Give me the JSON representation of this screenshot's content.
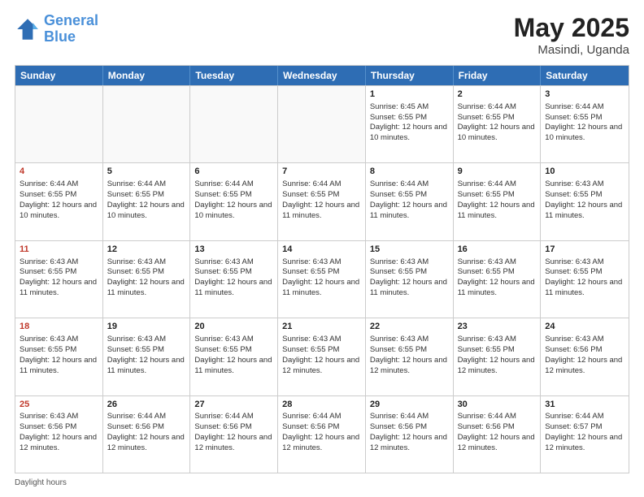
{
  "logo": {
    "line1": "General",
    "line2": "Blue"
  },
  "title": "May 2025",
  "location": "Masindi, Uganda",
  "days_of_week": [
    "Sunday",
    "Monday",
    "Tuesday",
    "Wednesday",
    "Thursday",
    "Friday",
    "Saturday"
  ],
  "footer": "Daylight hours",
  "weeks": [
    [
      {
        "day": "",
        "empty": true
      },
      {
        "day": "",
        "empty": true
      },
      {
        "day": "",
        "empty": true
      },
      {
        "day": "",
        "empty": true
      },
      {
        "day": "1",
        "sunrise": "Sunrise: 6:45 AM",
        "sunset": "Sunset: 6:55 PM",
        "daylight": "Daylight: 12 hours and 10 minutes."
      },
      {
        "day": "2",
        "sunrise": "Sunrise: 6:44 AM",
        "sunset": "Sunset: 6:55 PM",
        "daylight": "Daylight: 12 hours and 10 minutes."
      },
      {
        "day": "3",
        "sunrise": "Sunrise: 6:44 AM",
        "sunset": "Sunset: 6:55 PM",
        "daylight": "Daylight: 12 hours and 10 minutes."
      }
    ],
    [
      {
        "day": "4",
        "sunrise": "Sunrise: 6:44 AM",
        "sunset": "Sunset: 6:55 PM",
        "daylight": "Daylight: 12 hours and 10 minutes."
      },
      {
        "day": "5",
        "sunrise": "Sunrise: 6:44 AM",
        "sunset": "Sunset: 6:55 PM",
        "daylight": "Daylight: 12 hours and 10 minutes."
      },
      {
        "day": "6",
        "sunrise": "Sunrise: 6:44 AM",
        "sunset": "Sunset: 6:55 PM",
        "daylight": "Daylight: 12 hours and 10 minutes."
      },
      {
        "day": "7",
        "sunrise": "Sunrise: 6:44 AM",
        "sunset": "Sunset: 6:55 PM",
        "daylight": "Daylight: 12 hours and 11 minutes."
      },
      {
        "day": "8",
        "sunrise": "Sunrise: 6:44 AM",
        "sunset": "Sunset: 6:55 PM",
        "daylight": "Daylight: 12 hours and 11 minutes."
      },
      {
        "day": "9",
        "sunrise": "Sunrise: 6:44 AM",
        "sunset": "Sunset: 6:55 PM",
        "daylight": "Daylight: 12 hours and 11 minutes."
      },
      {
        "day": "10",
        "sunrise": "Sunrise: 6:43 AM",
        "sunset": "Sunset: 6:55 PM",
        "daylight": "Daylight: 12 hours and 11 minutes."
      }
    ],
    [
      {
        "day": "11",
        "sunrise": "Sunrise: 6:43 AM",
        "sunset": "Sunset: 6:55 PM",
        "daylight": "Daylight: 12 hours and 11 minutes."
      },
      {
        "day": "12",
        "sunrise": "Sunrise: 6:43 AM",
        "sunset": "Sunset: 6:55 PM",
        "daylight": "Daylight: 12 hours and 11 minutes."
      },
      {
        "day": "13",
        "sunrise": "Sunrise: 6:43 AM",
        "sunset": "Sunset: 6:55 PM",
        "daylight": "Daylight: 12 hours and 11 minutes."
      },
      {
        "day": "14",
        "sunrise": "Sunrise: 6:43 AM",
        "sunset": "Sunset: 6:55 PM",
        "daylight": "Daylight: 12 hours and 11 minutes."
      },
      {
        "day": "15",
        "sunrise": "Sunrise: 6:43 AM",
        "sunset": "Sunset: 6:55 PM",
        "daylight": "Daylight: 12 hours and 11 minutes."
      },
      {
        "day": "16",
        "sunrise": "Sunrise: 6:43 AM",
        "sunset": "Sunset: 6:55 PM",
        "daylight": "Daylight: 12 hours and 11 minutes."
      },
      {
        "day": "17",
        "sunrise": "Sunrise: 6:43 AM",
        "sunset": "Sunset: 6:55 PM",
        "daylight": "Daylight: 12 hours and 11 minutes."
      }
    ],
    [
      {
        "day": "18",
        "sunrise": "Sunrise: 6:43 AM",
        "sunset": "Sunset: 6:55 PM",
        "daylight": "Daylight: 12 hours and 11 minutes."
      },
      {
        "day": "19",
        "sunrise": "Sunrise: 6:43 AM",
        "sunset": "Sunset: 6:55 PM",
        "daylight": "Daylight: 12 hours and 11 minutes."
      },
      {
        "day": "20",
        "sunrise": "Sunrise: 6:43 AM",
        "sunset": "Sunset: 6:55 PM",
        "daylight": "Daylight: 12 hours and 11 minutes."
      },
      {
        "day": "21",
        "sunrise": "Sunrise: 6:43 AM",
        "sunset": "Sunset: 6:55 PM",
        "daylight": "Daylight: 12 hours and 12 minutes."
      },
      {
        "day": "22",
        "sunrise": "Sunrise: 6:43 AM",
        "sunset": "Sunset: 6:55 PM",
        "daylight": "Daylight: 12 hours and 12 minutes."
      },
      {
        "day": "23",
        "sunrise": "Sunrise: 6:43 AM",
        "sunset": "Sunset: 6:55 PM",
        "daylight": "Daylight: 12 hours and 12 minutes."
      },
      {
        "day": "24",
        "sunrise": "Sunrise: 6:43 AM",
        "sunset": "Sunset: 6:56 PM",
        "daylight": "Daylight: 12 hours and 12 minutes."
      }
    ],
    [
      {
        "day": "25",
        "sunrise": "Sunrise: 6:43 AM",
        "sunset": "Sunset: 6:56 PM",
        "daylight": "Daylight: 12 hours and 12 minutes."
      },
      {
        "day": "26",
        "sunrise": "Sunrise: 6:44 AM",
        "sunset": "Sunset: 6:56 PM",
        "daylight": "Daylight: 12 hours and 12 minutes."
      },
      {
        "day": "27",
        "sunrise": "Sunrise: 6:44 AM",
        "sunset": "Sunset: 6:56 PM",
        "daylight": "Daylight: 12 hours and 12 minutes."
      },
      {
        "day": "28",
        "sunrise": "Sunrise: 6:44 AM",
        "sunset": "Sunset: 6:56 PM",
        "daylight": "Daylight: 12 hours and 12 minutes."
      },
      {
        "day": "29",
        "sunrise": "Sunrise: 6:44 AM",
        "sunset": "Sunset: 6:56 PM",
        "daylight": "Daylight: 12 hours and 12 minutes."
      },
      {
        "day": "30",
        "sunrise": "Sunrise: 6:44 AM",
        "sunset": "Sunset: 6:56 PM",
        "daylight": "Daylight: 12 hours and 12 minutes."
      },
      {
        "day": "31",
        "sunrise": "Sunrise: 6:44 AM",
        "sunset": "Sunset: 6:57 PM",
        "daylight": "Daylight: 12 hours and 12 minutes."
      }
    ]
  ]
}
